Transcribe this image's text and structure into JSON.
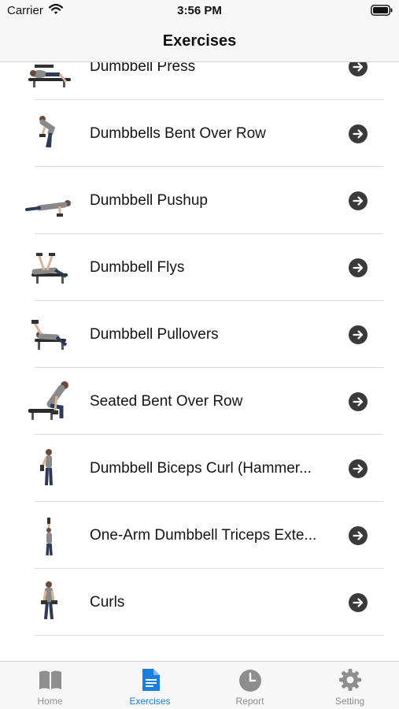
{
  "status_bar": {
    "carrier": "Carrier",
    "time": "3:56 PM"
  },
  "nav": {
    "title": "Exercises"
  },
  "exercises": [
    {
      "label": "Dumbbell Press",
      "thumb_icon": "bench-press-figure-icon"
    },
    {
      "label": "Dumbbells Bent Over Row",
      "thumb_icon": "bent-over-row-figure-icon"
    },
    {
      "label": "Dumbbell Pushup",
      "thumb_icon": "pushup-figure-icon"
    },
    {
      "label": "Dumbbell Flys",
      "thumb_icon": "flys-figure-icon"
    },
    {
      "label": "Dumbbell Pullovers",
      "thumb_icon": "pullover-figure-icon"
    },
    {
      "label": "Seated Bent Over Row",
      "thumb_icon": "seated-row-figure-icon"
    },
    {
      "label": "Dumbbell Biceps Curl (Hammer...",
      "thumb_icon": "hammer-curl-figure-icon"
    },
    {
      "label": "One-Arm Dumbbell Triceps Exte...",
      "thumb_icon": "triceps-extension-figure-icon"
    },
    {
      "label": "Curls",
      "thumb_icon": "curls-figure-icon"
    }
  ],
  "tabs": [
    {
      "label": "Home",
      "icon": "book-icon",
      "active": false
    },
    {
      "label": "Exercises",
      "icon": "document-icon",
      "active": true
    },
    {
      "label": "Report",
      "icon": "clock-icon",
      "active": false
    },
    {
      "label": "Setting",
      "icon": "gear-icon",
      "active": false
    }
  ],
  "colors": {
    "accent": "#1a7de0",
    "inactive_tab": "#8e8e8e",
    "arrow": "#3a3a3a"
  }
}
